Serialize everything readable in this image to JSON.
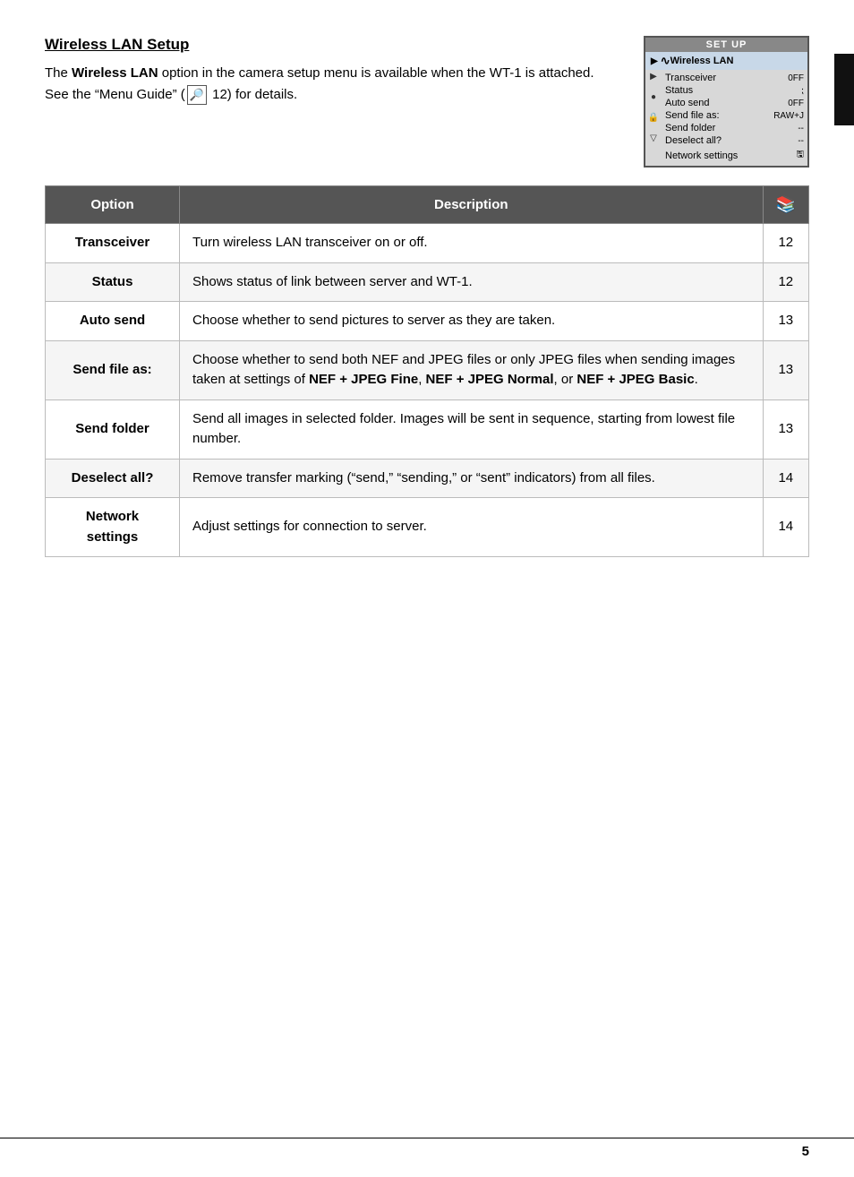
{
  "page": {
    "title": "Wireless LAN Setup",
    "intro_prefix": "The ",
    "intro_bold": "Wireless  LAN",
    "intro_suffix": " option in the camera setup menu is available when the WT-1 is attached.  See the “Menu Guide” (",
    "intro_book_icon": "✦",
    "intro_page_ref": "12) for details.",
    "page_number": "5"
  },
  "camera_menu": {
    "title": "SET  UP",
    "wireless_lan_label": "Wireless LAN",
    "items": [
      {
        "label": "Transceiver",
        "value": "0FF"
      },
      {
        "label": "Status",
        "value": "╫"
      },
      {
        "label": "Auto send",
        "value": "0FF"
      },
      {
        "label": "Send file as:",
        "value": "RAW+J"
      },
      {
        "label": "Send folder",
        "value": "--"
      },
      {
        "label": "Deselect all?",
        "value": "--"
      },
      {
        "label": "Network settings",
        "value": "🖫"
      }
    ],
    "icons": [
      "▶",
      "●",
      "🔒",
      "▽"
    ]
  },
  "table": {
    "headers": {
      "option": "Option",
      "description": "Description",
      "page_icon": "📖"
    },
    "rows": [
      {
        "option": "Transceiver",
        "description": "Turn wireless LAN transceiver on or off.",
        "page": "12"
      },
      {
        "option": "Status",
        "description": "Shows status of link between server and WT-1.",
        "page": "12"
      },
      {
        "option": "Auto send",
        "description": "Choose whether to send pictures to server as they are taken.",
        "page": "13"
      },
      {
        "option": "Send file as:",
        "description_parts": [
          "Choose  whether  to  send  both  NEF  and  JPEG  files  or  only JPEG files when sending images taken at settings of ",
          "NEF + JPEG Fine",
          ", ",
          "NEF + JPEG Normal",
          ", or ",
          "NEF + JPEG Basic",
          "."
        ],
        "page": "13"
      },
      {
        "option": "Send folder",
        "description": "Send all images in selected folder.  Images will be sent in sequence, starting from lowest file number.",
        "page": "13"
      },
      {
        "option": "Deselect all?",
        "description": "Remove transfer marking (“send,”  “sending,”  or “sent”  indicators) from all files.",
        "page": "14"
      },
      {
        "option": "Network\nsettings",
        "description": "Adjust settings for connection to server.",
        "page": "14"
      }
    ]
  }
}
